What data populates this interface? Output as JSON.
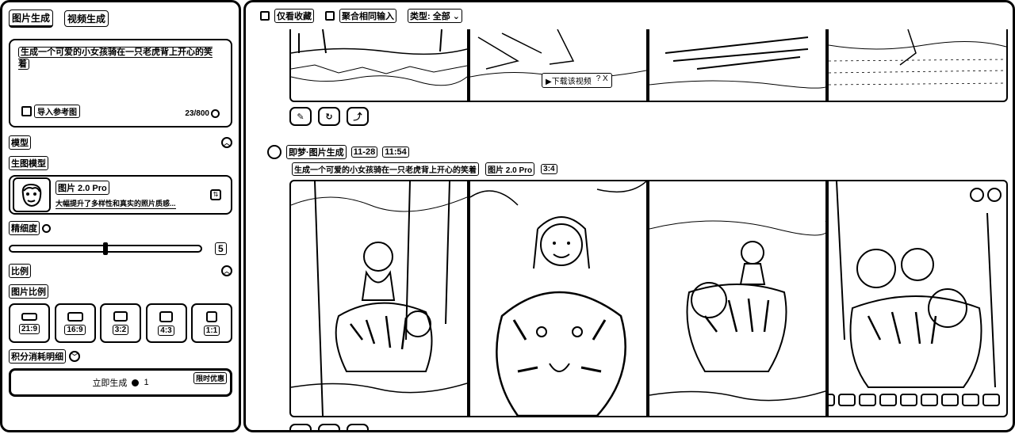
{
  "left_panel": {
    "tabs": [
      {
        "label": "图片生成",
        "active": true
      },
      {
        "label": "视频生成",
        "active": false
      }
    ],
    "prompt": {
      "text": "生成一个可爱的小女孩骑在一只老虎背上开心的笑着",
      "upload_label": "导入参考图",
      "counter": "23/800"
    },
    "model_section": {
      "title": "模型",
      "subtitle": "生图模型",
      "model_name": "图片 2.0 Pro",
      "model_desc": "大幅提升了多样性和真实的照片质感..."
    },
    "detail": {
      "label": "精细度",
      "value": "5",
      "fraction": 0.5
    },
    "ratio_section": {
      "title": "比例",
      "subtitle": "图片比例",
      "options": [
        "21:9",
        "16:9",
        "3:2",
        "4:3",
        "1:1"
      ]
    },
    "points_label": "积分消耗明细",
    "generate": {
      "label": "立即生成",
      "cost": "1",
      "promo": "限时优惠"
    }
  },
  "right_panel": {
    "toolbar": {
      "favorites_label": "仅看收藏",
      "merge_label": "聚合相同输入",
      "type_label": "类型: 全部"
    },
    "top_group": {
      "video_bar_text": "▶下载该视频",
      "video_bar_extra": "?  X"
    },
    "record": {
      "source": "即梦·图片生成",
      "date": "11-28",
      "time": "11:54",
      "prompt": "生成一个可爱的小女孩骑在一只老虎背上开心的笑着",
      "model": "图片 2.0 Pro",
      "ratio": "3:4"
    }
  }
}
